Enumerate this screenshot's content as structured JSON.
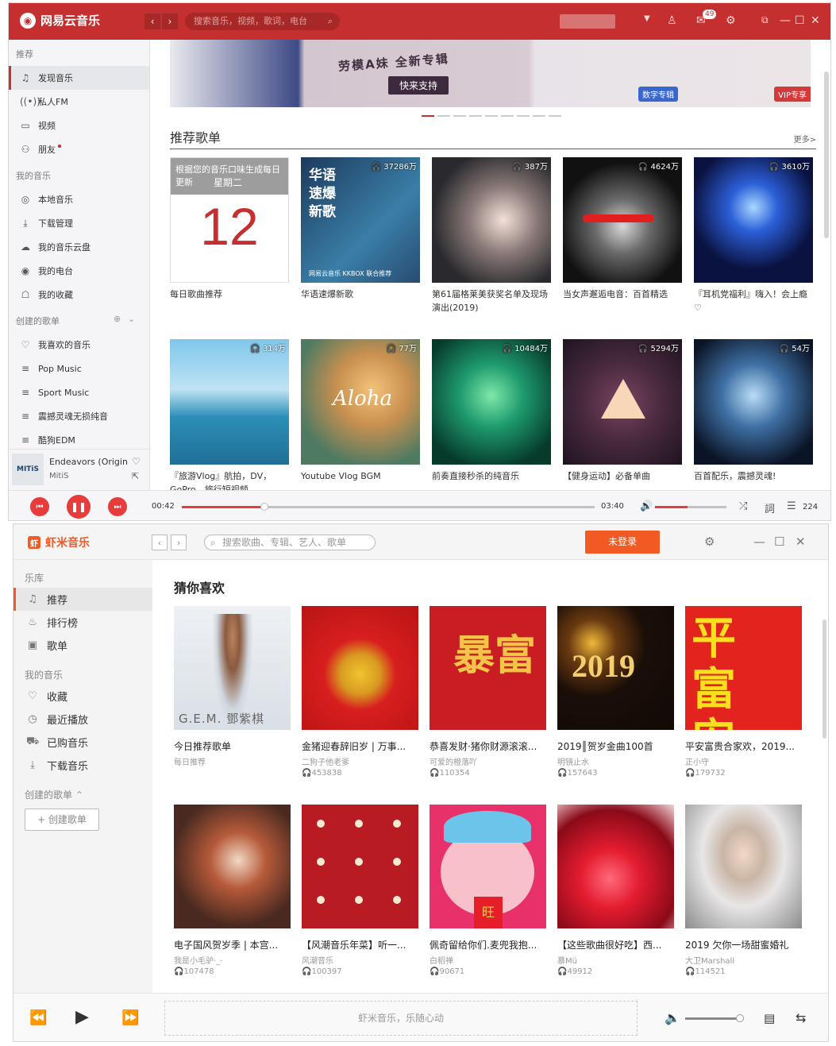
{
  "netease": {
    "app_name": "网易云音乐",
    "search_placeholder": "搜索音乐，视频，歌词，电台",
    "mail_badge": "49",
    "sidebar": {
      "sec_recommend": "推荐",
      "recommend_items": [
        "发现音乐",
        "私人FM",
        "视频",
        "朋友"
      ],
      "sec_mymusic": "我的音乐",
      "mymusic_items": [
        "本地音乐",
        "下载管理",
        "我的音乐云盘",
        "我的电台",
        "我的收藏"
      ],
      "sec_created": "创建的歌单",
      "created_items": [
        "我喜欢的音乐",
        "Pop Music",
        "Sport Music",
        "震撼灵魂无损纯音",
        "酷狗EDM"
      ]
    },
    "now_playing": {
      "cover_text": "MITiS",
      "title": "Endeavors (Origin...",
      "artist": "MitiS"
    },
    "banner": {
      "headline": "劳模A妹 全新专辑",
      "button": "快来支持",
      "tag1": "数字专辑",
      "tag2": "VIP专享"
    },
    "section_title": "推荐歌单",
    "more": "更多>",
    "daily": {
      "header": "根据您的音乐口味生成每日更新",
      "weekday": "星期二",
      "day": "12"
    },
    "playlists": [
      {
        "title": "每日歌曲推荐",
        "plays": ""
      },
      {
        "title": "华语速爆新歌",
        "plays": "37286万",
        "cover_text": "华语速爆新歌",
        "cover_sub": "网易云音乐 KKBOX 联合推荐"
      },
      {
        "title": "第61届格莱美获奖名单及现场演出(2019)",
        "plays": "387万"
      },
      {
        "title": "当女声邂逅电音：百首精选",
        "plays": "4624万"
      },
      {
        "title": "『耳机党福利』嗨入！会上瘾♡",
        "plays": "3610万"
      },
      {
        "title": "『旅游Vlog』航拍，DV，GoPro，旅行短视频",
        "plays": "314万"
      },
      {
        "title": "Youtube Vlog BGM",
        "plays": "77万",
        "cover_text": "Aloha"
      },
      {
        "title": "前奏直接秒杀的纯音乐",
        "plays": "10484万"
      },
      {
        "title": "【健身运动】必备单曲",
        "plays": "5294万"
      },
      {
        "title": "百首配乐，震撼灵魂!",
        "plays": "54万"
      }
    ],
    "player": {
      "elapsed": "00:42",
      "total": "03:40",
      "progress": 0.2,
      "volume": 0.45,
      "list_count": "224"
    }
  },
  "xiami": {
    "app_name": "虾米音乐",
    "search_placeholder": "搜索歌曲、专辑、艺人、歌单",
    "login": "未登录",
    "sidebar": {
      "sec_library": "乐库",
      "library_items": [
        "推荐",
        "排行榜",
        "歌单"
      ],
      "sec_mymusic": "我的音乐",
      "mymusic_items": [
        "收藏",
        "最近播放",
        "已购音乐",
        "下载音乐"
      ],
      "sec_created": "创建的歌单",
      "new_list": "+ 创建歌单"
    },
    "section_title": "猜你喜欢",
    "cards": [
      {
        "title": "今日推荐歌单",
        "sub": "每日推荐",
        "plays": "",
        "cover_text": "G.E.M. 鄧紫棋"
      },
      {
        "title": "金猪迎春辞旧岁 | 万事...",
        "sub": "二狗子他老爹",
        "plays": "453838",
        "cover_text": ""
      },
      {
        "title": "恭喜发财·猪你财源滚滚...",
        "sub": "可爱的橙落吖",
        "plays": "110354",
        "cover_text": "暴富"
      },
      {
        "title": "2019║贺岁金曲100首",
        "sub": "明镜止水",
        "plays": "157643",
        "cover_text": "2019"
      },
      {
        "title": "平安富贵合家欢，2019...",
        "sub": "正小守",
        "plays": "179732",
        "cover_text": "平富安贵"
      },
      {
        "title": "电子国风贺岁季 | 本宫...",
        "sub": "我是小毛驴·_·",
        "plays": "107478",
        "cover_text": ""
      },
      {
        "title": "【风潮音乐年菜】听一...",
        "sub": "风潮音乐",
        "plays": "100397",
        "cover_text": ""
      },
      {
        "title": "佩奇留给你们.麦兜我抱...",
        "sub": "白稻禅",
        "plays": "90671",
        "cover_text": "旺"
      },
      {
        "title": "【这些歌曲很好吃】西...",
        "sub": "慕Mü",
        "plays": "49912",
        "cover_text": ""
      },
      {
        "title": "2019 欠你一场甜蜜婚礼",
        "sub": "大卫Marshall",
        "plays": "114521",
        "cover_text": ""
      }
    ],
    "player": {
      "slogan": "虾米音乐，乐随心动",
      "volume": 0.9
    }
  }
}
